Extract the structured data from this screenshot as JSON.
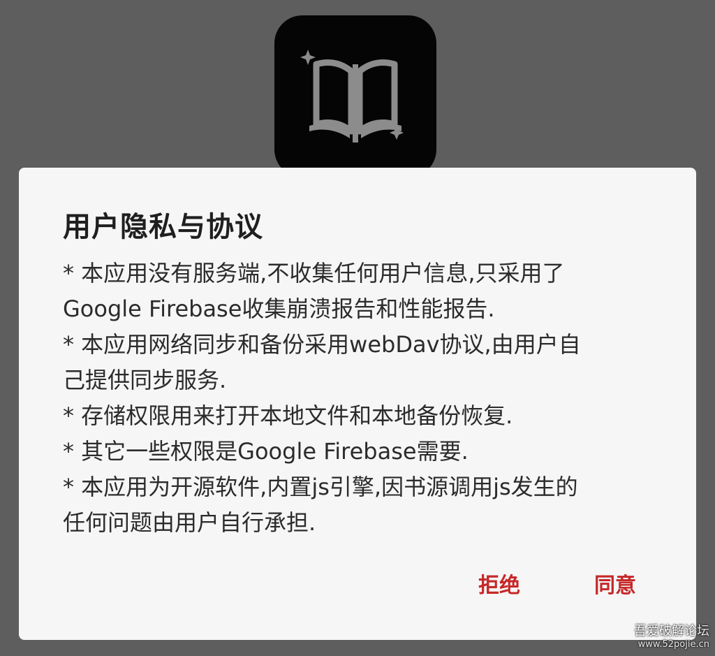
{
  "background_color": "#5e5e5e",
  "app_icon": {
    "icon": "book-icon",
    "background": "#050505",
    "foreground": "#8c8c8c"
  },
  "dialog": {
    "title": "用户隐私与协议",
    "body_lines": [
      "* 本应用没有服务端,不收集任何用户信息,只采用了",
      "Google Firebase收集崩溃报告和性能报告.",
      "* 本应用网络同步和备份采用webDav协议,由用户自",
      "己提供同步服务.",
      "* 存储权限用来打开本地文件和本地备份恢复.",
      "* 其它一些权限是Google Firebase需要.",
      "* 本应用为开源软件,内置js引擎,因书源调用js发生的",
      "任何问题由用户自行承担."
    ],
    "buttons": {
      "refuse": "拒绝",
      "agree": "同意"
    },
    "accent_color": "#c62828"
  },
  "watermark": {
    "title": "吾爱破解论坛",
    "url": "www.52pojie.cn"
  }
}
